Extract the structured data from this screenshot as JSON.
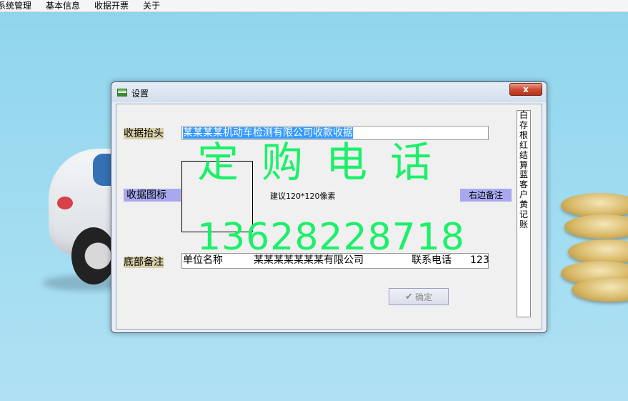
{
  "menubar": {
    "items": [
      "系统管理",
      "基本信息",
      "收据开票",
      "关于"
    ]
  },
  "dialog": {
    "title": "设置",
    "close_label": "x",
    "header_label": "收据抬头",
    "header_value": "某某某某机动车检测有限公司收款收据",
    "icon_label": "收据图标",
    "icon_hint": "建议120*120像素",
    "right_note_label": "右边备注",
    "footer_label": "底部备注",
    "footer": {
      "company_label": "单位名称",
      "company_value": "某某某某某某某有限公司",
      "phone_label": "联系电话",
      "phone_value": "123"
    },
    "ok_label": "确定",
    "right_legend": [
      "白",
      "存",
      "根",
      "红",
      "结",
      "算",
      "蓝",
      "客",
      "户",
      "黄",
      "记",
      "账"
    ]
  },
  "watermark": {
    "line1": "定购电话",
    "line2": "13628228718"
  },
  "colors": {
    "watermark": "#1cf06a",
    "label_highlight_tan": "#d9cfa8",
    "label_highlight_lavender": "#a9a8ee",
    "selection": "#3399ff",
    "close_button": "#cf4b35"
  }
}
